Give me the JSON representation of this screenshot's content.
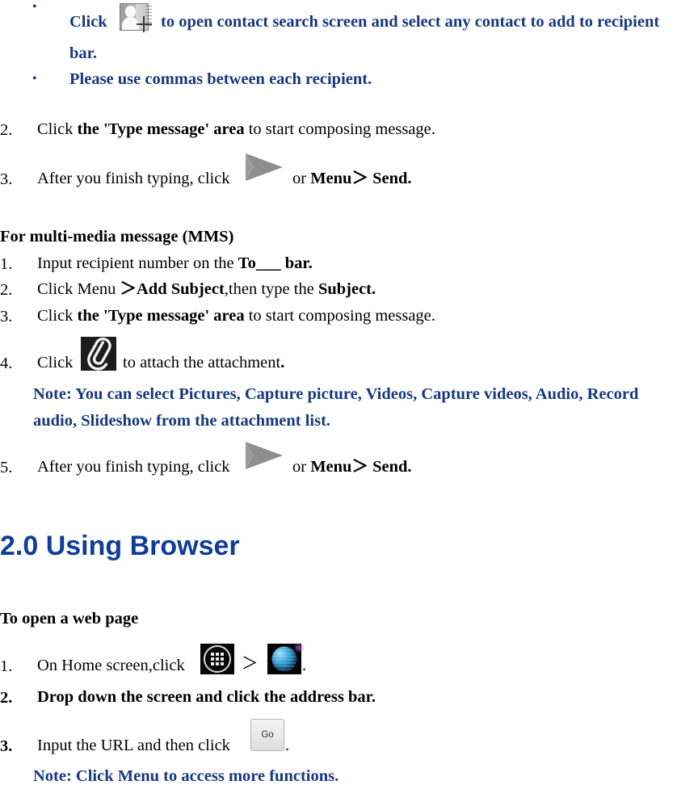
{
  "document": {
    "sms_bullets": [
      {
        "pre": "Click",
        "icon": "contact-add-icon",
        "post": "to open contact search screen and select any contact to add to recipient bar.",
        "line1": "to open contact search screen and select any contact to add to recipient",
        "line2": "bar."
      },
      {
        "text": "Please use commas between each recipient."
      }
    ],
    "sms_steps": [
      {
        "number": "2.",
        "pre": "Click ",
        "bold": "the 'Type message' area",
        "post": " to start composing message."
      },
      {
        "number": "3.",
        "pre": "After you finish typing, click",
        "icon": "send-arrow-icon",
        "mid": "or ",
        "bold": "Menu＞ Send."
      }
    ],
    "mms": {
      "title": "For multi-media message (MMS)",
      "steps": [
        {
          "number": "1.",
          "pre": "Input recipient number on the ",
          "bold": "To___ bar."
        },
        {
          "number": "2.",
          "pre": "Click Menu  ",
          "bold1": "＞Add Subject",
          "mid": ",then type the ",
          "bold2": "Subject."
        },
        {
          "number": "3.",
          "pre": "Click ",
          "bold": "the 'Type message' area",
          "post": " to start composing message."
        },
        {
          "number": "4.",
          "pre": "Click",
          "icon": "paperclip-icon",
          "post": "to attach the attachment",
          "period": "."
        },
        {
          "number": "5.",
          "pre": "After you finish typing, click",
          "icon": "send-arrow-icon",
          "mid": "or ",
          "bold": "Menu＞ Send."
        }
      ],
      "note_line1": "Note: You can select Pictures, Capture picture, Videos, Capture videos, Audio, Record",
      "note_line2": "audio, Slideshow from the attachment list."
    },
    "browser": {
      "heading": "2.0 Using Browser",
      "subheading": "To open a web page",
      "steps": [
        {
          "number": "1.",
          "pre": "On Home screen,click",
          "icon1": "app-drawer-icon",
          "separator": "＞",
          "icon2": "browser-globe-icon",
          "period": "."
        },
        {
          "number": "2.",
          "text": "Drop down the screen and click the address bar."
        },
        {
          "number": "3.",
          "pre": "Input the URL and then click",
          "icon": "go-button-icon",
          "period": "."
        }
      ],
      "go_label": "Go",
      "note": "Note:    Click Menu to access more functions."
    },
    "colors": {
      "blue_text": "#17387E",
      "heading_blue": "#0F3D99",
      "body_text": "#000000"
    }
  }
}
